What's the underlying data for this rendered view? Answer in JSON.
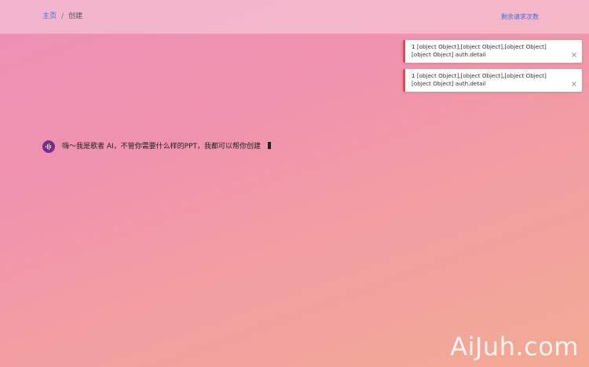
{
  "breadcrumb": {
    "home": "主页",
    "separator": "/",
    "current": "创建"
  },
  "header": {
    "quota_link": "剩余请求次数"
  },
  "chat": {
    "greeting": "嗨～我是歌者 AI，不管你需要什么样的PPT，我都可以帮你创建"
  },
  "toasts": [
    {
      "message": "1 [object Object],[object Object],[object Object] [object Object] auth.detail",
      "type": "error"
    },
    {
      "message": "1 [object Object],[object Object],[object Object] [object Object] auth.detail",
      "type": "error"
    }
  ],
  "watermark": "AiJuh.com",
  "colors": {
    "link": "#3f6fd8",
    "error_accent": "#e5484d",
    "avatar_bg": "#7a2b8f"
  },
  "icons": {
    "avatar": "soundwave-logo-icon",
    "toast_close": "close-icon"
  }
}
